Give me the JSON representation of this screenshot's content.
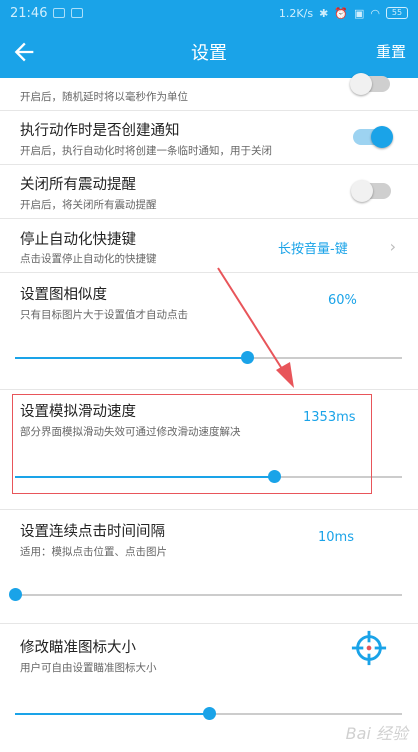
{
  "status_bar": {
    "time": "21:46",
    "net_speed": "1.2K/s",
    "battery": "55"
  },
  "header": {
    "title": "设置",
    "reset_label": "重置"
  },
  "colors": {
    "accent": "#1aa3e8",
    "highlight": "#e8555a"
  },
  "rows": {
    "random_delay": {
      "desc": "开启后，随机延时将以毫秒作为单位",
      "enabled": false
    },
    "create_notification": {
      "title": "执行动作时是否创建通知",
      "desc": "开启后，执行自动化时将创建一条临时通知，用于关闭",
      "enabled": true
    },
    "disable_vibration": {
      "title": "关闭所有震动提醒",
      "desc": "开启后，将关闭所有震动提醒",
      "enabled": false
    },
    "stop_shortcut": {
      "title": "停止自动化快捷键",
      "desc": "点击设置停止自动化的快捷键",
      "value": "长按音量-键"
    },
    "image_similarity": {
      "title": "设置图相似度",
      "desc": "只有目标图片大于设置值才自动点击",
      "value": "60%",
      "slider_fraction": 0.6
    },
    "swipe_speed": {
      "title": "设置模拟滑动速度",
      "desc": "部分界面模拟滑动失效可通过修改滑动速度解决",
      "value": "1353ms",
      "slider_fraction": 0.67
    },
    "click_interval": {
      "title": "设置连续点击时间间隔",
      "desc": "适用：模拟点击位置、点击图片",
      "value": "10ms",
      "slider_fraction": 0.0
    },
    "crosshair_size": {
      "title": "修改瞄准图标大小",
      "desc": "用户可自由设置瞄准图标大小",
      "slider_fraction": 0.5
    }
  },
  "icons": {
    "back": "arrow-left-icon",
    "chevron": "chevron-right-icon",
    "crosshair": "crosshair-icon"
  },
  "watermark": "Bai 经验"
}
